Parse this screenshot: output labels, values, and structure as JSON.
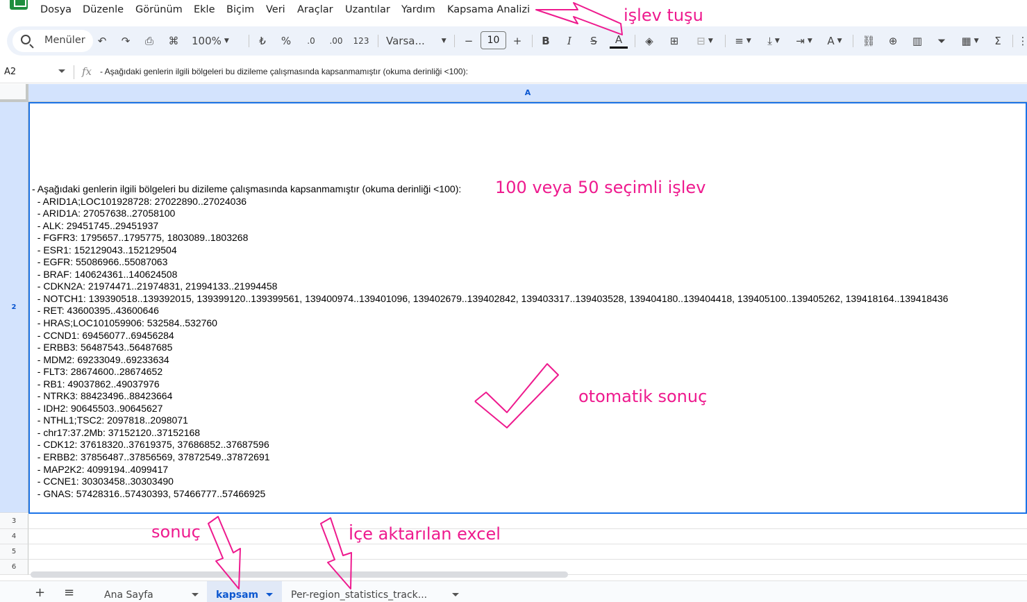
{
  "menu": {
    "items": [
      "Dosya",
      "Düzenle",
      "Görünüm",
      "Ekle",
      "Biçim",
      "Veri",
      "Araçlar",
      "Uzantılar",
      "Yardım",
      "Kapsama Analizi"
    ]
  },
  "toolbar": {
    "search_label": "Menüler",
    "zoom": "100%",
    "currency": "₺",
    "percent": "%",
    "decrease_decimals": ".0",
    "increase_decimals": ".00",
    "number_format": "123",
    "font": "Varsa...",
    "font_size": "10",
    "bold": "B",
    "italic": "I",
    "strike": "S",
    "text_color": "A"
  },
  "formula_bar": {
    "cell_ref": "A2",
    "fx": "fx",
    "content": "- Aşağıdaki genlerin ilgili bölgeleri bu dizileme çalışmasında kapsanmamıştır (okuma derinliği <100):"
  },
  "grid": {
    "column_header": "A",
    "rows": [
      "2",
      "3",
      "4",
      "5",
      "6"
    ],
    "cell_a2": "- Aşağıdaki genlerin ilgili bölgeleri bu dizileme çalışmasında kapsanmamıştır (okuma derinliği <100):\n  - ARID1A;LOC101928728: 27022890..27024036\n  - ARID1A: 27057638..27058100\n  - ALK: 29451745..29451937\n  - FGFR3: 1795657..1795775, 1803089..1803268\n  - ESR1: 152129043..152129504\n  - EGFR: 55086966..55087063\n  - BRAF: 140624361..140624508\n  - CDKN2A: 21974471..21974831, 21994133..21994458\n  - NOTCH1: 139390518..139392015, 139399120..139399561, 139400974..139401096, 139402679..139402842, 139403317..139403528, 139404180..139404418, 139405100..139405262, 139418164..139418436\n  - RET: 43600395..43600646\n  - HRAS;LOC101059906: 532584..532760\n  - CCND1: 69456077..69456284\n  - ERBB3: 56487543..56487685\n  - MDM2: 69233049..69233634\n  - FLT3: 28674600..28674652\n  - RB1: 49037862..49037976\n  - NTRK3: 88423496..88423664\n  - IDH2: 90645503..90645627\n  - NTHL1;TSC2: 2097818..2098071\n  - chr17:37.2Mb: 37152120..37152168\n  - CDK12: 37618320..37619375, 37686852..37687596\n  - ERBB2: 37856487..37856569, 37872549..37872691\n  - MAP2K2: 4099194..4099417\n  - CCNE1: 30303458..30303490\n  - GNAS: 57428316..57430393, 57466777..57466925"
  },
  "sheets": {
    "tabs": [
      "Ana Sayfa",
      "kapsam",
      "Per-region_statistics_track..."
    ],
    "active": "kapsam"
  },
  "annotations": {
    "function_key": "işlev tuşu",
    "selectable": "100 veya 50 seçimli işlev",
    "auto_result": "otomatik sonuç",
    "result": "sonuç",
    "imported_excel": "İçe aktarılan excel"
  },
  "colors": {
    "annotation": "#ee1a8e",
    "selection": "#1a73e8",
    "header_selected": "#d3e3fd",
    "toolbar_bg": "#edf2fa"
  }
}
